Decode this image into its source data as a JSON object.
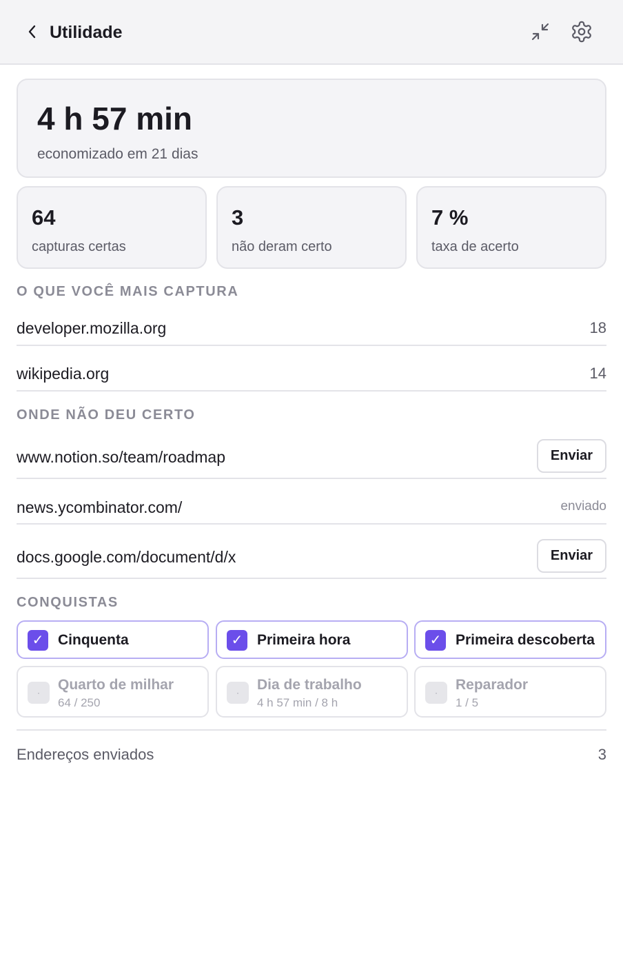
{
  "header": {
    "title": "Utilidade",
    "back_icon": "chevron-left-icon",
    "collapse_icon": "collapse-arrows-icon",
    "settings_icon": "gear-icon"
  },
  "summary": {
    "saved_time": "4 h 57 min",
    "saved_caption": "economizado em 21 dias"
  },
  "stats": [
    {
      "value": "64",
      "label": "capturas certas"
    },
    {
      "value": "3",
      "label": "não deram certo"
    },
    {
      "value": "7 %",
      "label": "taxa de acerto"
    }
  ],
  "top_captured": {
    "title": "O QUE VOCÊ MAIS CAPTURA",
    "items": [
      {
        "domain": "developer.mozilla.org",
        "count": "18"
      },
      {
        "domain": "wikipedia.org",
        "count": "14"
      }
    ]
  },
  "failures": {
    "title": "ONDE NÃO DEU CERTO",
    "items": [
      {
        "url": "www.notion.so/team/roadmap",
        "action": "Enviar"
      },
      {
        "url": "news.ycombinator.com/",
        "status": "enviado"
      },
      {
        "url": "docs.google.com/document/d/x",
        "action": "Enviar"
      }
    ]
  },
  "achievements": {
    "title": "CONQUISTAS",
    "check_glyph": "✓",
    "locked_glyph": "·",
    "completed": [
      {
        "name": "Cinquenta"
      },
      {
        "name": "Primeira hora"
      },
      {
        "name": "Primeira descoberta"
      }
    ],
    "pending": [
      {
        "name": "Quarto de milhar",
        "progress": "64 / 250"
      },
      {
        "name": "Dia de trabalho",
        "progress": "4 h 57 min / 8 h"
      },
      {
        "name": "Reparador",
        "progress": "1 / 5"
      }
    ]
  },
  "footer": {
    "label": "Endereços enviados",
    "count": "3"
  },
  "colors": {
    "accent": "#6b4eea",
    "header_bg": "#f4f4f6",
    "card_bg": "#f4f4f7",
    "muted_text": "#8b8b96"
  }
}
